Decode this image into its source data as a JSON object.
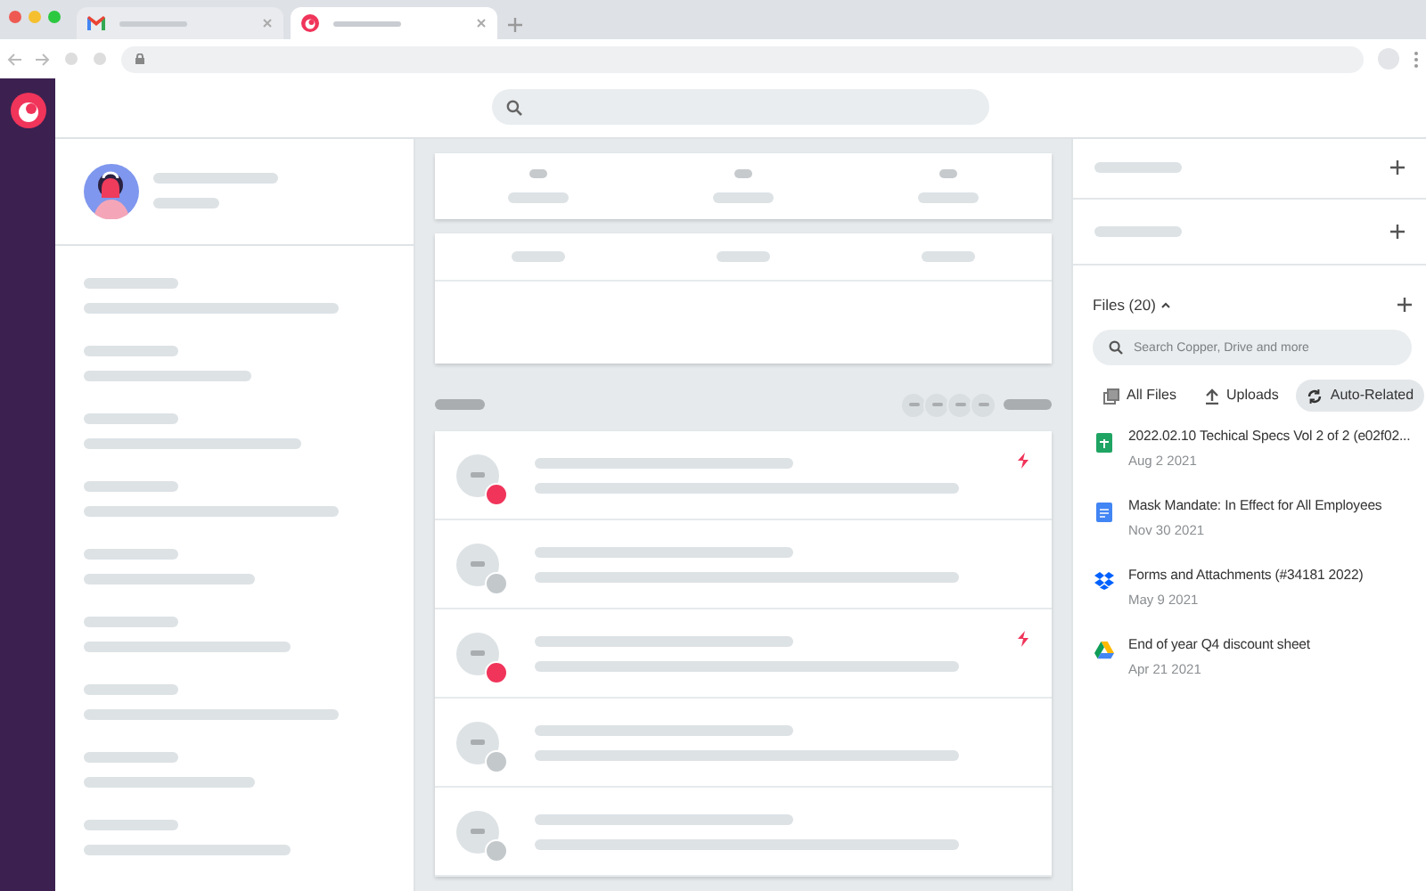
{
  "browser_tabs": [
    {
      "kind": "mail",
      "selected": false
    },
    {
      "kind": "copper",
      "selected": true
    }
  ],
  "activities": [
    {
      "flagged": true
    },
    {
      "flagged": false
    },
    {
      "flagged": true
    },
    {
      "flagged": false
    },
    {
      "flagged": false
    }
  ],
  "files_panel": {
    "title": "Files (20)",
    "expanded": true,
    "search": {
      "placeholder": "Search Copper, Drive and more"
    },
    "filters": [
      {
        "label": "All Files",
        "kind": "all",
        "selected": false
      },
      {
        "label": "Uploads",
        "kind": "uploads",
        "selected": false
      },
      {
        "label": "Auto-Related",
        "kind": "related",
        "selected": true
      }
    ],
    "files": [
      {
        "name": "2022.02.10 Techical Specs Vol 2 of 2 (e02f02...",
        "date": "Aug 2 2021",
        "kind": "sheet"
      },
      {
        "name": "Mask Mandate: In Effect for All Employees",
        "date": "Nov 30 2021",
        "kind": "doc"
      },
      {
        "name": "Forms and Attachments (#34181 2022)",
        "date": "May 9 2021",
        "kind": "dropbox"
      },
      {
        "name": "End of year Q4 discount sheet",
        "date": "Apr 21 2021",
        "kind": "drive"
      }
    ]
  }
}
